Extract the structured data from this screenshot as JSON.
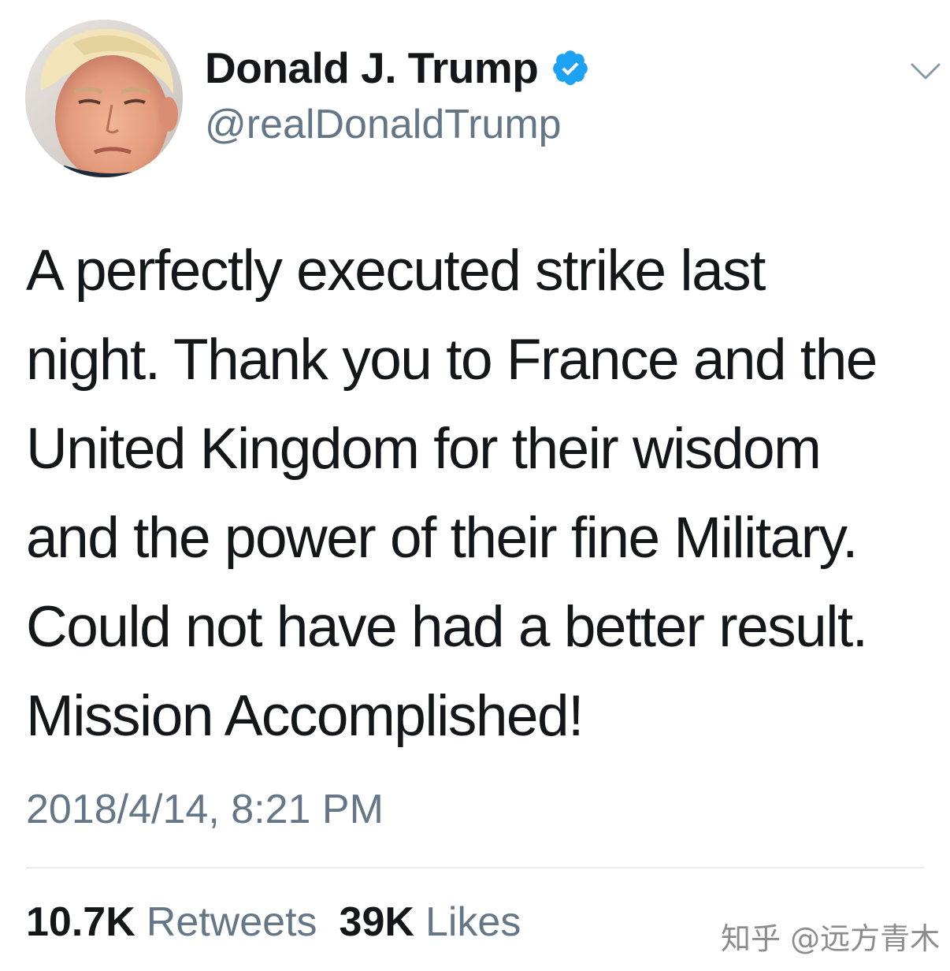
{
  "author": {
    "display_name": "Donald J. Trump",
    "handle": "@realDonaldTrump",
    "verified_icon": "verified-badge-icon",
    "avatar_icon": "profile-photo"
  },
  "menu": {
    "icon": "chevron-down-icon"
  },
  "tweet": {
    "text": "A perfectly executed strike last\nnight. Thank you to France and the\nUnited Kingdom for their wisdom\nand the power of their fine Military.\nCould not have had a better result.\nMission Accomplished!",
    "timestamp": "2018/4/14, 8:21 PM"
  },
  "stats": {
    "retweets_count": "10.7K",
    "retweets_label": "Retweets",
    "likes_count": "39K",
    "likes_label": "Likes"
  },
  "watermark": "知乎 @远方青木",
  "colors": {
    "verified_blue": "#1da1f2",
    "secondary_text": "#657786",
    "primary_text": "#14171a"
  }
}
